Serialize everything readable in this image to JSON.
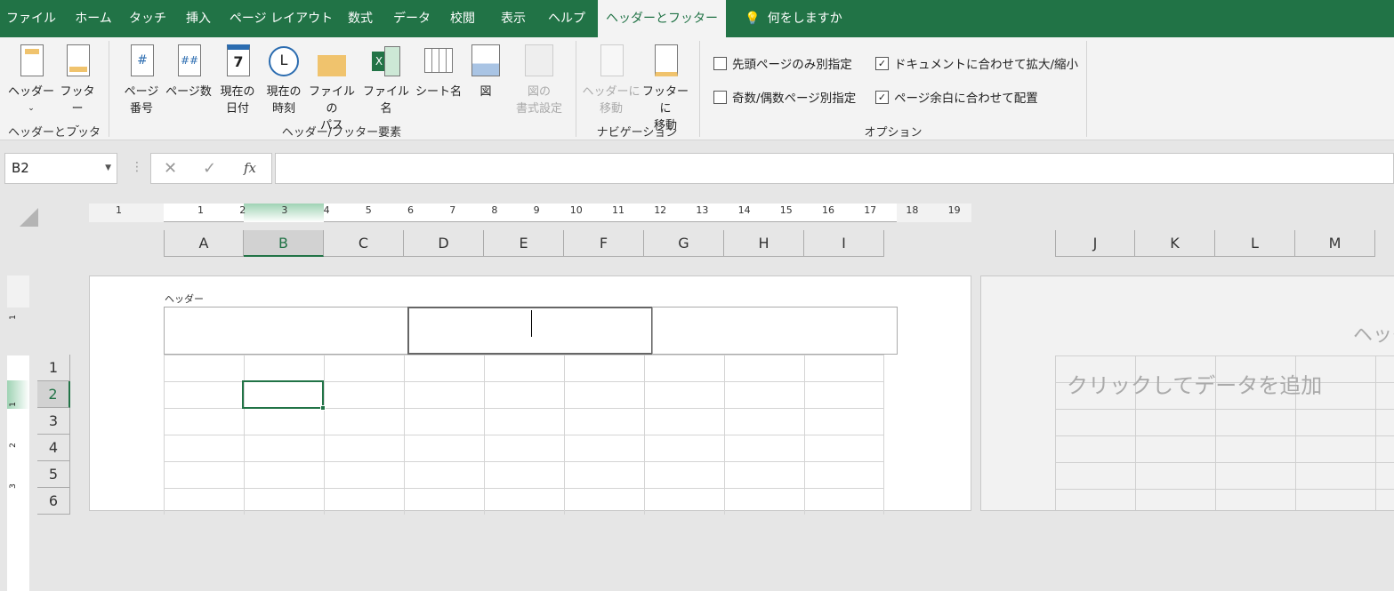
{
  "tabs": [
    "ファイル",
    "ホーム",
    "タッチ",
    "挿入",
    "ページ レイアウト",
    "数式",
    "データ",
    "校閲",
    "表示",
    "ヘルプ",
    "ヘッダーとフッター"
  ],
  "tell_me": "何をしますか",
  "ribbon": {
    "groups": {
      "hf": {
        "label": "ヘッダーとフッター",
        "header": "ヘッダー",
        "footer": "フッター"
      },
      "elements": {
        "label": "ヘッダー/フッター要素",
        "items": [
          {
            "l1": "ページ",
            "l2": "番号",
            "icon": "page-number-icon"
          },
          {
            "l1": "ページ数",
            "l2": "",
            "icon": "page-count-icon"
          },
          {
            "l1": "現在の",
            "l2": "日付",
            "icon": "calendar-icon"
          },
          {
            "l1": "現在の",
            "l2": "時刻",
            "icon": "clock-icon"
          },
          {
            "l1": "ファイルの",
            "l2": "パス",
            "icon": "folder-icon"
          },
          {
            "l1": "ファイル名",
            "l2": "",
            "icon": "excel-file-icon"
          },
          {
            "l1": "シート名",
            "l2": "",
            "icon": "sheet-icon"
          },
          {
            "l1": "図",
            "l2": "",
            "icon": "picture-icon"
          },
          {
            "l1": "図の",
            "l2": "書式設定",
            "icon": "format-picture-icon"
          }
        ]
      },
      "nav": {
        "label": "ナビゲーション",
        "to_header": [
          "ヘッダーに",
          "移動"
        ],
        "to_footer": [
          "フッターに",
          "移動"
        ]
      },
      "options": {
        "label": "オプション",
        "items": [
          {
            "label": "先頭ページのみ別指定",
            "checked": false
          },
          {
            "label": "奇数/偶数ページ別指定",
            "checked": false
          },
          {
            "label": "ドキュメントに合わせて拡大/縮小",
            "checked": true
          },
          {
            "label": "ページ余白に合わせて配置",
            "checked": true
          }
        ]
      }
    }
  },
  "formula_bar": {
    "name_box": "B2",
    "fx": "fx",
    "value": ""
  },
  "ruler": {
    "left": [
      "1"
    ],
    "marks": [
      "1",
      "2",
      "3",
      "4",
      "5",
      "6",
      "7",
      "8",
      "9",
      "10",
      "11",
      "12",
      "13",
      "14",
      "15",
      "16",
      "17",
      "18",
      "19"
    ]
  },
  "vruler": [
    "1",
    "1",
    "2",
    "3"
  ],
  "columns": [
    "A",
    "B",
    "C",
    "D",
    "E",
    "F",
    "G",
    "H",
    "I"
  ],
  "columns2": [
    "J",
    "K",
    "L",
    "M"
  ],
  "rows": [
    "1",
    "2",
    "3",
    "4",
    "5",
    "6"
  ],
  "page1": {
    "header_label": "ヘッダー"
  },
  "page2": {
    "header_label": "ヘッダー",
    "placeholder": "クリックしてデータを追加"
  },
  "selected_cell": "B2",
  "colors": {
    "accent": "#217346"
  }
}
